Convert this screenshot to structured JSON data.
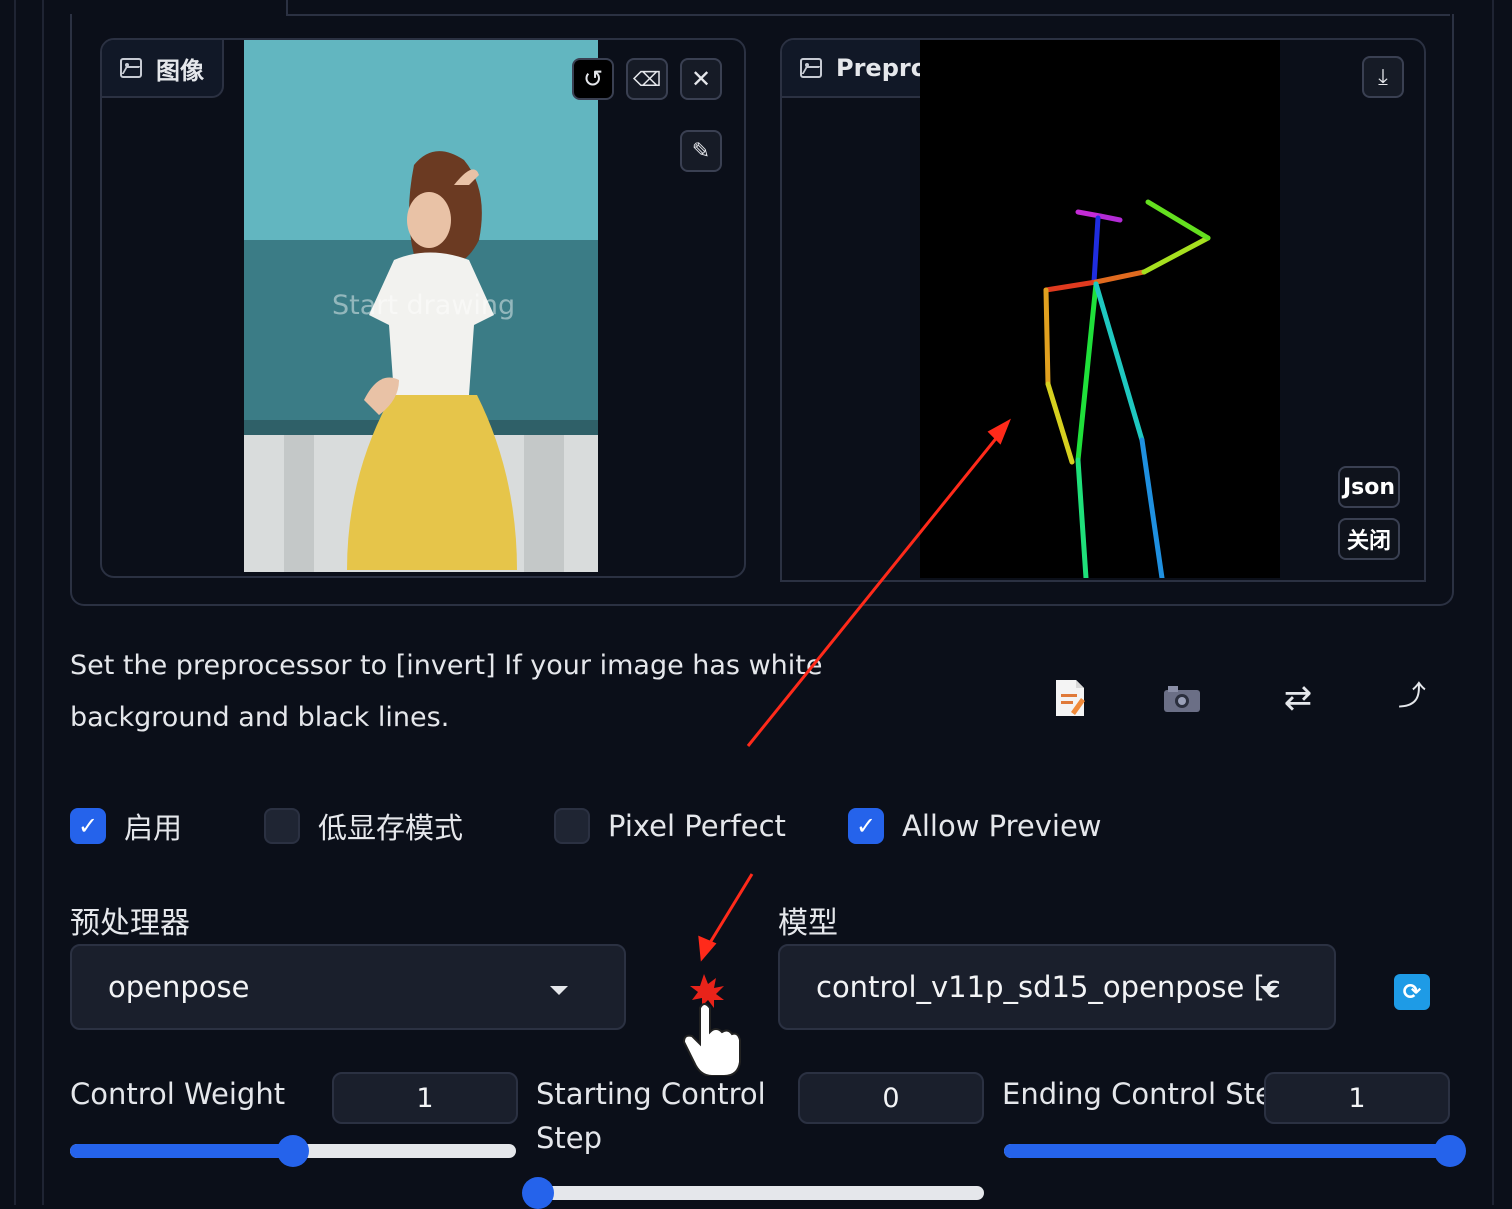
{
  "image_panel": {
    "label": "图像",
    "placeholder": "Start drawing"
  },
  "preview_panel": {
    "label": "Preprocessor Preview",
    "json_button": "Json",
    "close_button": "关闭"
  },
  "info_text": "Set the preprocessor to [invert] If your image has white background and black lines.",
  "checkboxes": [
    {
      "label": "启用",
      "checked": true
    },
    {
      "label": "低显存模式",
      "checked": false
    },
    {
      "label": "Pixel Perfect",
      "checked": false
    },
    {
      "label": "Allow Preview",
      "checked": true
    }
  ],
  "preprocessor": {
    "label": "预处理器",
    "value": "openpose"
  },
  "model": {
    "label": "模型",
    "value": "control_v11p_sd15_openpose [c"
  },
  "sliders": {
    "control_weight": {
      "label": "Control Weight",
      "value": "1",
      "fraction": 0.5
    },
    "starting_step": {
      "label": "Starting Control Step",
      "value": "0",
      "fraction": 0.0
    },
    "ending_step": {
      "label": "Ending Control Step",
      "value": "1",
      "fraction": 1.0
    }
  },
  "colors": {
    "accent": "#2563eb",
    "background": "#0b0f19",
    "annotation_arrow": "#ff2a1a"
  },
  "icons": [
    "image-icon",
    "undo-icon",
    "eraser-icon",
    "close-icon",
    "brush-icon",
    "download-icon",
    "notepad-icon",
    "camera-icon",
    "swap-icon",
    "send-icon",
    "refresh-icon"
  ]
}
